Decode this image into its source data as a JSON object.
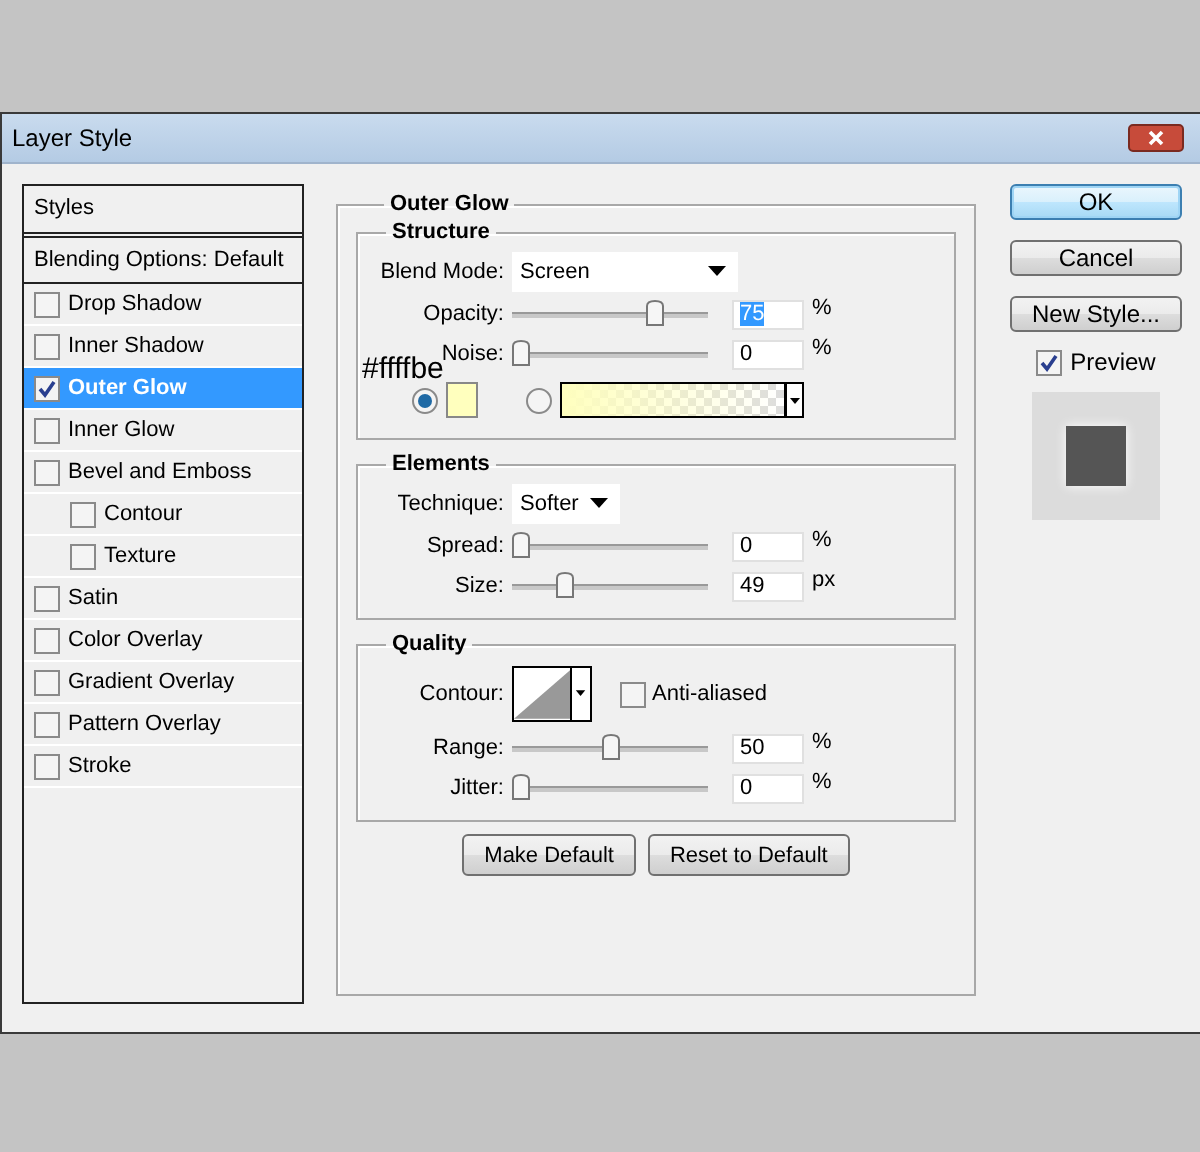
{
  "window": {
    "title": "Layer Style"
  },
  "styles_list": {
    "header": "Styles",
    "items": [
      {
        "kind": "plain",
        "label": "Blending Options: Default",
        "selected": false
      },
      {
        "kind": "check",
        "label": "Drop Shadow",
        "checked": false,
        "selected": false
      },
      {
        "kind": "check",
        "label": "Inner Shadow",
        "checked": false,
        "selected": false
      },
      {
        "kind": "check",
        "label": "Outer Glow",
        "checked": true,
        "selected": true
      },
      {
        "kind": "check",
        "label": "Inner Glow",
        "checked": false,
        "selected": false
      },
      {
        "kind": "check",
        "label": "Bevel and Emboss",
        "checked": false,
        "selected": false,
        "children": [
          {
            "kind": "check",
            "label": "Contour",
            "checked": false,
            "selected": false
          },
          {
            "kind": "check",
            "label": "Texture",
            "checked": false,
            "selected": false
          }
        ]
      },
      {
        "kind": "check",
        "label": "Satin",
        "checked": false,
        "selected": false
      },
      {
        "kind": "check",
        "label": "Color Overlay",
        "checked": false,
        "selected": false
      },
      {
        "kind": "check",
        "label": "Gradient Overlay",
        "checked": false,
        "selected": false
      },
      {
        "kind": "check",
        "label": "Pattern Overlay",
        "checked": false,
        "selected": false
      },
      {
        "kind": "check",
        "label": "Stroke",
        "checked": false,
        "selected": false
      }
    ]
  },
  "panel": {
    "title": "Outer Glow",
    "annotation": "#ffffbe",
    "sections": [
      {
        "title": "Structure",
        "rows": [
          {
            "kind": "select",
            "label": "Blend Mode:",
            "value": "Screen"
          },
          {
            "kind": "slider",
            "label": "Opacity:",
            "level": 0.75,
            "value": "75",
            "unit": "%",
            "selected": true
          },
          {
            "kind": "slider",
            "label": "Noise:",
            "level": 0,
            "value": "0",
            "unit": "%",
            "selected": false
          },
          {
            "kind": "color",
            "color": "#ffffbe",
            "radios": [
              {
                "selected": true
              },
              {
                "selected": false
              }
            ]
          }
        ]
      },
      {
        "title": "Elements",
        "rows": [
          {
            "kind": "select",
            "label": "Technique:",
            "value": "Softer"
          },
          {
            "kind": "slider",
            "label": "Spread:",
            "level": 0,
            "value": "0",
            "unit": "%",
            "selected": false
          },
          {
            "kind": "slider",
            "label": "Size:",
            "level": 0.25,
            "value": "49",
            "unit": "px",
            "selected": false
          }
        ]
      },
      {
        "title": "Quality",
        "rows": [
          {
            "kind": "contour",
            "label": "Contour:",
            "checkbox": {
              "label": "Anti-aliased",
              "checked": false
            }
          },
          {
            "kind": "slider",
            "label": "Range:",
            "level": 0.5,
            "value": "50",
            "unit": "%",
            "selected": false
          },
          {
            "kind": "slider",
            "label": "Jitter:",
            "level": 0,
            "value": "0",
            "unit": "%",
            "selected": false
          }
        ]
      }
    ],
    "buttons": [
      "Make Default",
      "Reset to Default"
    ]
  },
  "side": {
    "buttons": [
      {
        "label": "OK",
        "default": true
      },
      {
        "label": "Cancel",
        "default": false
      },
      {
        "label": "New Style...",
        "default": false
      }
    ],
    "preview": {
      "label": "Preview",
      "checked": true
    }
  }
}
